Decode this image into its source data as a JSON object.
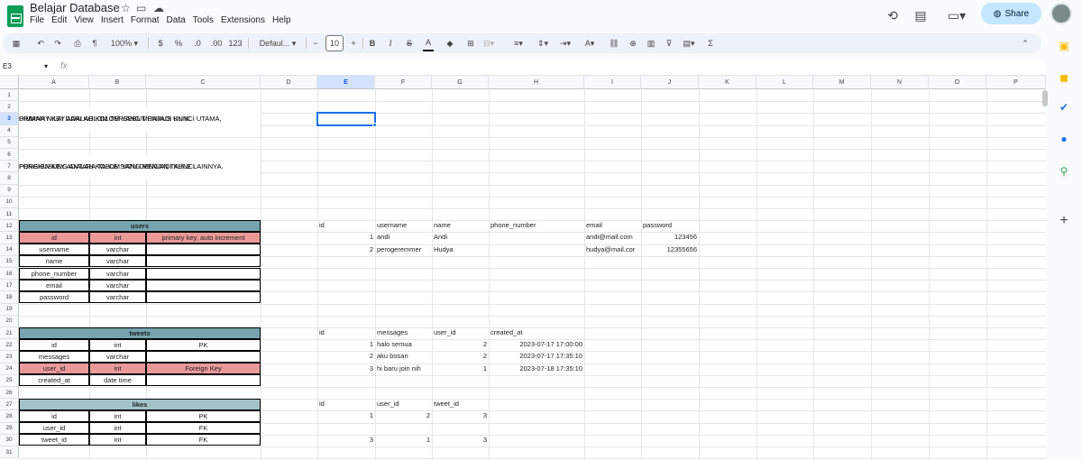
{
  "app": {
    "title": "Belajar Database",
    "menus": [
      "File",
      "Edit",
      "View",
      "Insert",
      "Format",
      "Data",
      "Tools",
      "Extensions",
      "Help"
    ],
    "share_label": "Share"
  },
  "toolbar": {
    "zoom": "100%",
    "currency": "$",
    "percent": "%",
    "dec_less": ".0",
    "dec_more": ".00",
    "format_num": "123",
    "font": "Defaul...",
    "font_size": "10",
    "bold": "B",
    "italic": "I",
    "strike": "S",
    "textcolor": "A",
    "minus": "−",
    "plus": "+"
  },
  "formula": {
    "namebox": "E3",
    "fx": "fx",
    "value": ""
  },
  "columns": [
    "A",
    "B",
    "C",
    "D",
    "E",
    "F",
    "G",
    "H",
    "I",
    "J",
    "K",
    "L",
    "M",
    "N",
    "O",
    "P"
  ],
  "selected": {
    "column": "E",
    "row": "3"
  },
  "rows": [
    "1",
    "2",
    "3",
    "4",
    "5",
    "6",
    "7",
    "8",
    "9",
    "10",
    "11",
    "12",
    "13",
    "14",
    "15",
    "16",
    "17",
    "18",
    "19",
    "20",
    "21",
    "22",
    "23",
    "24",
    "25",
    "26",
    "27",
    "28",
    "29",
    "30",
    "31"
  ],
  "notes": {
    "pk_line1": "PRIMARY KEY ADALAH KOLOM YANG MENJADI KUNCI UTAMA,",
    "pk_line2": "DIMANA NILAI DARI KOLOM TERSEBUT HARUS UNIK.",
    "fk_line1": "FOREIGN KEY ADALAH KOLOM YANG MENJADI KUNCI",
    "fk_line2": "PENGHUBUNG ANTARA TABLE SATU DENGAN TABLE LAINNYA."
  },
  "users_table": {
    "title": "users",
    "rows": [
      [
        "id",
        "int",
        "primary key, auto increment"
      ],
      [
        "username",
        "varchar",
        ""
      ],
      [
        "name",
        "varchar",
        ""
      ],
      [
        "phone_number",
        "varchar",
        ""
      ],
      [
        "email",
        "varchar",
        ""
      ],
      [
        "password",
        "varchar",
        ""
      ]
    ]
  },
  "tweets_table": {
    "title": "tweets",
    "rows": [
      [
        "id",
        "int",
        "PK"
      ],
      [
        "messages",
        "varchar",
        ""
      ],
      [
        "user_id",
        "int",
        "Foreign Key"
      ],
      [
        "created_at",
        "date time",
        ""
      ]
    ]
  },
  "likes_table": {
    "title": "likes",
    "rows": [
      [
        "id",
        "int",
        "PK"
      ],
      [
        "user_id",
        "int",
        "FK"
      ],
      [
        "tweet_id",
        "int",
        "FK"
      ]
    ]
  },
  "users_data": {
    "headers": [
      "id",
      "username",
      "name",
      "phone_number",
      "email",
      "password"
    ],
    "rows": [
      [
        "1",
        "andi",
        "Andi",
        "",
        "andi@mail.com",
        "123456"
      ],
      [
        "2",
        "perogeremmer",
        "Hudya",
        "",
        "hudya@mail.cor",
        "12355656"
      ]
    ]
  },
  "tweets_data": {
    "headers": [
      "id",
      "messages",
      "user_id",
      "created_at"
    ],
    "rows": [
      [
        "1",
        "halo semua",
        "2",
        "2023-07-17 17:00:00"
      ],
      [
        "2",
        "aku bosan",
        "2",
        "2023-07-17 17:35:10"
      ],
      [
        "3",
        "hi baru join nih",
        "1",
        "2023-07-18 17:35:10"
      ]
    ]
  },
  "likes_data": {
    "headers": [
      "id",
      "user_id",
      "tweet_id"
    ],
    "rows": [
      [
        "1",
        "2",
        "3"
      ],
      [
        "",
        "",
        ""
      ],
      [
        "3",
        "1",
        "3"
      ]
    ]
  },
  "colors": {
    "header_fill": "#76a5af",
    "pink_fill": "#ea9999",
    "likes_fill": "#a2c4c9",
    "accent": "#1a73e8"
  }
}
